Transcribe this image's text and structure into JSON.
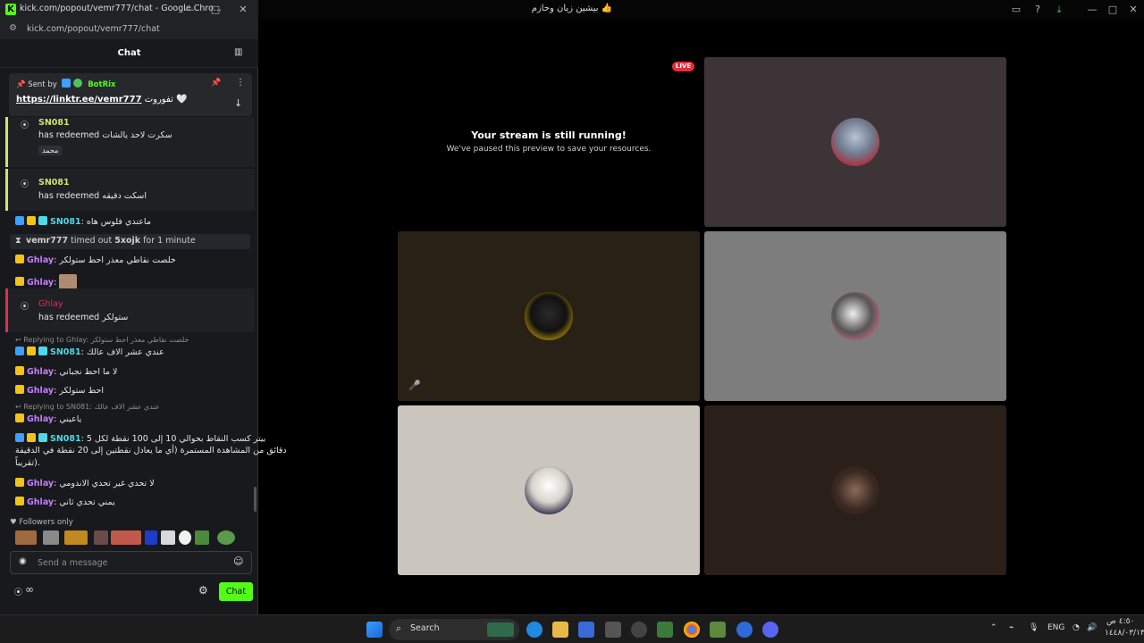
{
  "main": {
    "title": "بيشين زيان وحازم 👍",
    "live_label": "LIVE",
    "paused_title": "Your stream is still running!",
    "paused_subtitle": "We've paused this preview to save your resources."
  },
  "chat_window": {
    "title": "kick.com/popout/vemr777/chat - Google Chro...",
    "url": "kick.com/popout/vemr777/chat",
    "heading": "Chat",
    "pinned": {
      "sent_by_label": "Sent by",
      "sender": "BotRix",
      "link": "https://linktr.ee/vemr777",
      "text": "تفوروت 🤍"
    },
    "redeems": [
      {
        "user": "SN081",
        "text": "has redeemed سكرت لاحد يالشات",
        "tag": "محمد",
        "color": "#cfe26a"
      },
      {
        "user": "SN081",
        "text": "has redeemed اسكت دقيقه",
        "color": "#cfe26a"
      },
      {
        "user": "Ghlay",
        "text": "has redeemed ستولكر",
        "color": "#e0304c"
      }
    ],
    "messages": [
      {
        "user": "SN081",
        "text": "ماعندي فلوس هاه"
      },
      {
        "user": "Ghlay",
        "text": "خلصت نقاطي معذر احط ستولكر"
      },
      {
        "user": "Ghlay",
        "text": ""
      },
      {
        "user": "SN081",
        "text": "عندي عشر الاف عالك"
      },
      {
        "user": "Ghlay",
        "text": "لا ما احط نجباني"
      },
      {
        "user": "Ghlay",
        "text": "احط ستولكر"
      },
      {
        "user": "Ghlay",
        "text": "ياعيني"
      },
      {
        "user": "SN081",
        "text": "بيتر كسب النقاط بحوالي 10 إلى 100 نقطة لكل 5"
      },
      {
        "user": "Ghlay",
        "text": "لا تحدي غير تحدي الاندومي"
      },
      {
        "user": "Ghlay",
        "text": "يمني تحدي ثاني"
      }
    ],
    "message_continuation": [
      "دقائق من المشاهدة المستمرة (أي ما يعادل نقطتين إلى 20 نقطة في الدقيقة",
      "تقريباً)."
    ],
    "replies": [
      "Replying to Ghlay: خلصت نقاطي معذر احط ستولكر",
      "Replying to SN081: عندي عشر الاف عالك"
    ],
    "timeout": {
      "moderator": "vemr777",
      "text": "timed out",
      "target": "5xojk",
      "duration": "for 1 minute"
    },
    "followers_only": "Followers only",
    "input_placeholder": "Send a message",
    "infinity": "∞",
    "send_label": "Chat"
  },
  "taskbar": {
    "search_label": "Search",
    "language": "ENG",
    "time": "٤:٥٠ ص",
    "date": "١٤٤٨/٠٣/١٣"
  },
  "colors": {
    "kick_green": "#53fc18",
    "sn081": "#4fd8e8",
    "ghlay": "#c77dff",
    "ghlay_redeem": "#e0304c",
    "live_red": "#e0303c"
  }
}
